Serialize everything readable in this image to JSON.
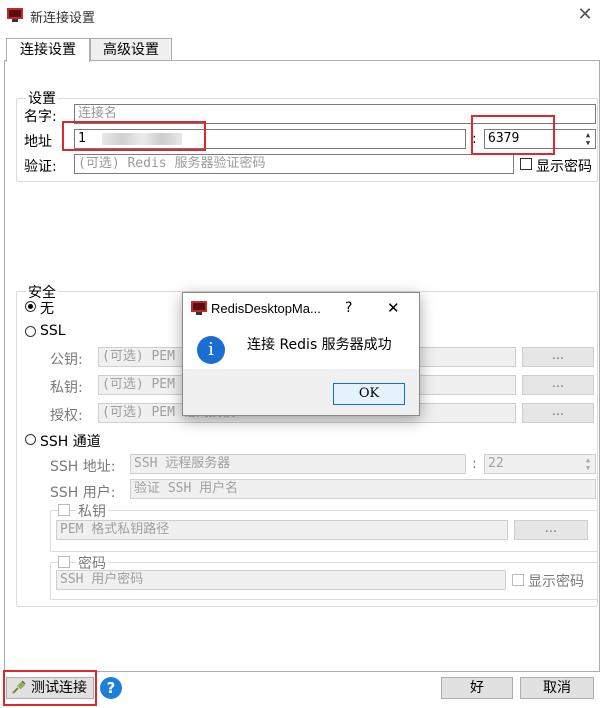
{
  "window": {
    "title": "新连接设置",
    "close_glyph": "✕"
  },
  "tabs": [
    {
      "label": "连接设置"
    },
    {
      "label": "高级设置"
    }
  ],
  "settings": {
    "group_title": "设置",
    "name_label": "名字:",
    "name_placeholder": "连接名",
    "address_label": "地址",
    "address_value": "1",
    "colon": ":",
    "port_value": "6379",
    "auth_label": "验证:",
    "auth_placeholder": "(可选) Redis 服务器验证密码",
    "show_password": "显示密码"
  },
  "security": {
    "group_title": "安全",
    "none_label": "无",
    "ssl_label": "SSL",
    "public_key_label": "公钥:",
    "public_key_placeholder": "(可选) PEM",
    "private_key_label": "私钥:",
    "private_key_placeholder": "(可选) PEM",
    "authority_label": "授权:",
    "authority_placeholder": "(可选) PEM 格式授权",
    "browse": "...",
    "ssh_label": "SSH 通道",
    "ssh_address_label": "SSH 地址:",
    "ssh_address_placeholder": "SSH 远程服务器",
    "ssh_port_value": "22",
    "ssh_user_label": "SSH 用户:",
    "ssh_user_placeholder": "验证 SSH 用户名",
    "private_key_group": "私钥",
    "pem_path_placeholder": "PEM 格式私钥路径",
    "password_group": "密码",
    "ssh_password_placeholder": "SSH 用户密码",
    "show_password": "显示密码"
  },
  "footer": {
    "test_connection": "测试连接",
    "help_glyph": "?",
    "ok": "好",
    "cancel": "取消"
  },
  "dialog": {
    "title": "RedisDesktopMa...",
    "help_glyph": "?",
    "close_glyph": "✕",
    "info_glyph": "i",
    "message": "连接 Redis 服务器成功",
    "ok": "OK"
  },
  "colors": {
    "highlight": "#e0282c",
    "info_blue": "#1a6ed1",
    "focus_blue": "#0078d7"
  }
}
